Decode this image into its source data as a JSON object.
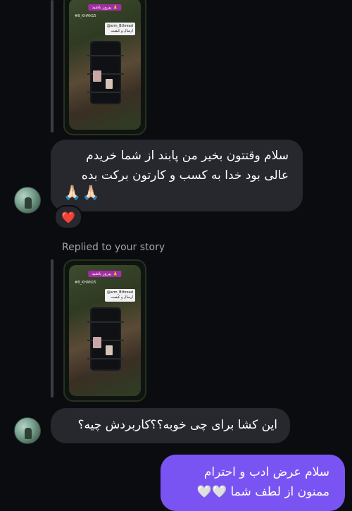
{
  "thread": {
    "story1": {
      "banner": "پیروز باشید 🙏",
      "tag": "#B_KHAN15",
      "card_line1": "@arm_Bthread",
      "card_line2": "ارسال و کیفیت"
    },
    "message1": {
      "line1": "سلام وقتتون بخیر من پابند از شما خریدم",
      "line2": "عالی بود خدا به کسب و کارتون برکت بده",
      "emoji": "🙏🏻🙏🏻"
    },
    "reaction1": "❤️",
    "replied_label": "Replied to your story",
    "story2": {
      "banner": "پیروز باشید 🙏",
      "tag": "#B_KHAN15",
      "card_line1": "@arm_Bthread",
      "card_line2": "ارسال و کیفیت"
    },
    "message2": {
      "text": "این کشا برای چی خوبه؟؟کاربردش چیه؟"
    },
    "sent_message": {
      "line1": "سلام عرض ادب و احترام",
      "line2": "ممنون از لطف شما 🤍🤍"
    }
  },
  "colors": {
    "background": "#0b0c10",
    "received_bubble": "#26282e",
    "sent_bubble": "#7a54f2",
    "muted_text": "#a2a4ab"
  }
}
